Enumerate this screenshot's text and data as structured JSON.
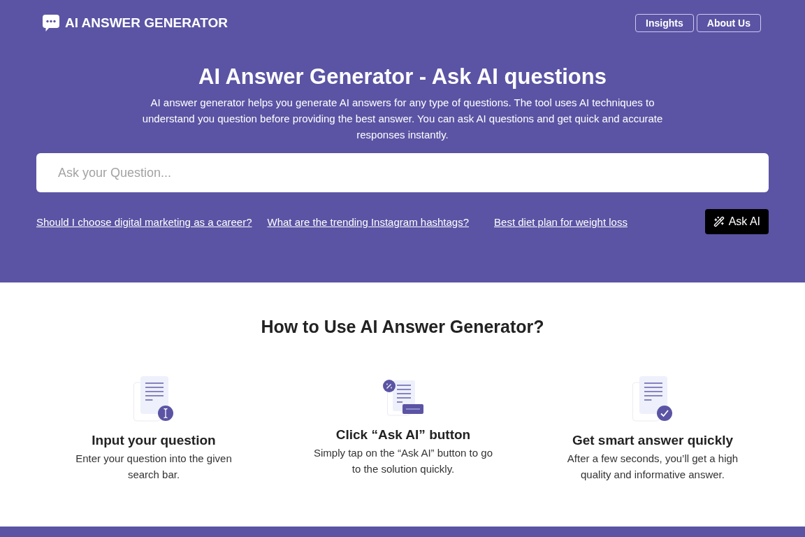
{
  "header": {
    "logo": {
      "text": "AI ANSWER GENERATOR"
    },
    "nav": [
      "Insights",
      "About Us"
    ]
  },
  "hero": {
    "title": "AI Answer Generator - Ask AI questions",
    "description": "AI answer generator helps you generate AI answers for any type of questions. The tool uses AI techniques to understand you question before providing the best answer. You can ask AI questions and get quick and accurate responses instantly.",
    "search": {
      "placeholder": "Ask your Question..."
    },
    "suggestions": [
      "Should I choose digital marketing as a career?",
      "What are the trending Instagram hashtags?",
      "Best diet plan for weight loss"
    ],
    "ask_button": "Ask AI"
  },
  "how_to": {
    "heading": "How to Use AI Answer Generator?",
    "steps": [
      {
        "kind": "input",
        "title": "Input your question",
        "description": "Enter your question into the given search bar."
      },
      {
        "kind": "click",
        "title": "Click “Ask AI” button",
        "description": "Simply tap on the “Ask AI” button to go to the solution quickly."
      },
      {
        "kind": "answer",
        "title": "Get smart answer quickly",
        "description": "After a few seconds, you’ll get a high quality and informative answer."
      }
    ]
  }
}
